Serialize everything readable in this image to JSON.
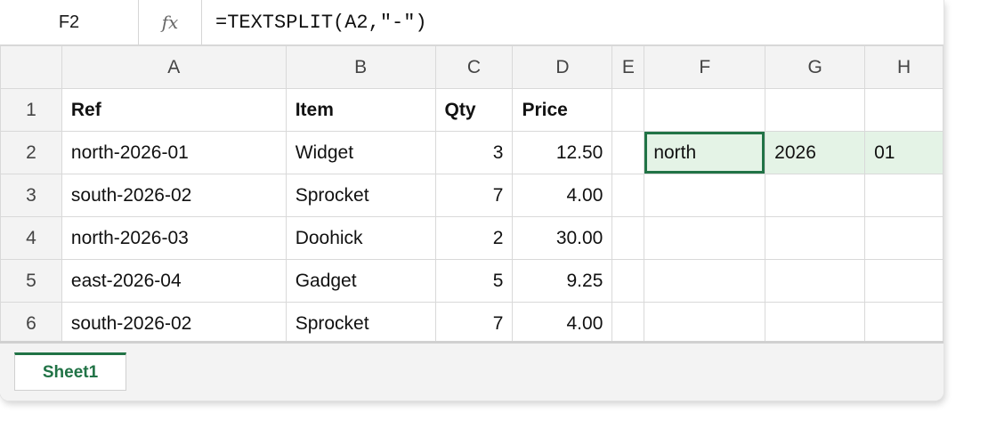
{
  "formula_bar": {
    "name_box": "F2",
    "fx_label": "fx",
    "formula": "=TEXTSPLIT(A2,\"-\")"
  },
  "columns": [
    "A",
    "B",
    "C",
    "D",
    "E",
    "F",
    "G",
    "H"
  ],
  "rows": [
    {
      "num": "1",
      "cells": [
        "Ref",
        "Item",
        "Qty",
        "Price",
        "",
        "",
        "",
        ""
      ]
    },
    {
      "num": "2",
      "cells": [
        "north-2026-01",
        "Widget",
        "3",
        "12.50",
        "",
        "north",
        "2026",
        "01"
      ]
    },
    {
      "num": "3",
      "cells": [
        "south-2026-02",
        "Sprocket",
        "7",
        "4.00",
        "",
        "",
        "",
        ""
      ]
    },
    {
      "num": "4",
      "cells": [
        "north-2026-03",
        "Doohick",
        "2",
        "30.00",
        "",
        "",
        "",
        ""
      ]
    },
    {
      "num": "5",
      "cells": [
        "east-2026-04",
        "Gadget",
        "5",
        "9.25",
        "",
        "",
        "",
        ""
      ]
    },
    {
      "num": "6",
      "cells": [
        "south-2026-02",
        "Sprocket",
        "7",
        "4.00",
        "",
        "",
        "",
        ""
      ]
    }
  ],
  "active_cell": "F2",
  "sheet_tabs": [
    "Sheet1"
  ],
  "colors": {
    "accent": "#217346",
    "spill_fill": "#e4f3e6",
    "header_fill": "#f3f3f3",
    "gridline": "#d9d9d9"
  }
}
